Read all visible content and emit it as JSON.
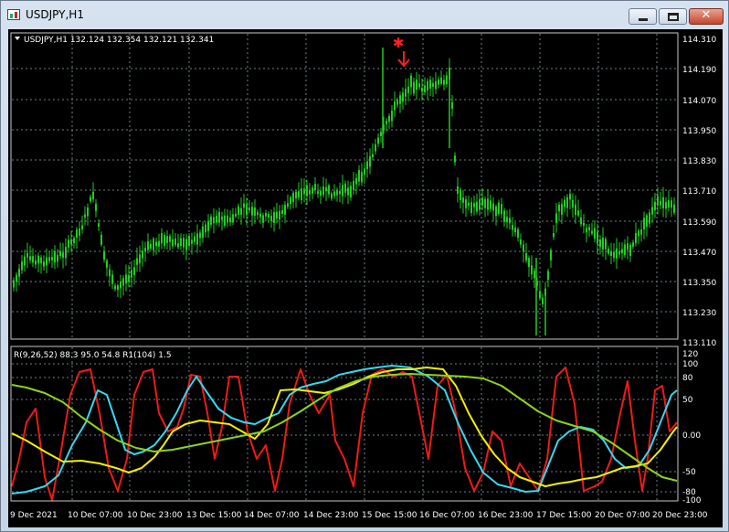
{
  "window": {
    "title": "USDJPY,H1"
  },
  "main_chart": {
    "info": "USDJPY,H1  132.124 132.354 132.121 132.341",
    "price_ticks": [
      "114.310",
      "114.190",
      "114.070",
      "113.950",
      "113.830",
      "113.710",
      "113.590",
      "113.470",
      "113.350",
      "113.230",
      "113.110"
    ]
  },
  "indicator": {
    "info": "R(9,26,52) 88.3 95.0 54.8  R1(104) 1.5",
    "ticks": [
      "120",
      "100",
      "80",
      "50",
      "0.00",
      "-50",
      "-80",
      "-100"
    ]
  },
  "time_axis": [
    "9 Dec 2021",
    "10 Dec 07:00",
    "10 Dec 23:00",
    "13 Dec 15:00",
    "14 Dec 07:00",
    "14 Dec 23:00",
    "15 Dec 15:00",
    "16 Dec 07:00",
    "16 Dec 23:00",
    "17 Dec 15:00",
    "20 Dec 07:00",
    "20 Dec 23:00"
  ],
  "colors": {
    "candles": "#22cc22",
    "grid": "#6e7f8a",
    "red": "#ee1a1a",
    "cyan": "#35d8f0",
    "yellow": "#f5f000",
    "lime": "#8bd41e",
    "marker": "#ff2020"
  },
  "icons": {
    "marker": "star-with-down-arrow",
    "menu": "triangle-down"
  }
}
